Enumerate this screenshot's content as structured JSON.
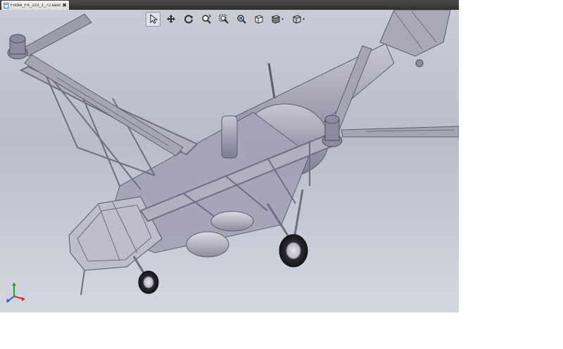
{
  "tab": {
    "title": "Focke_FA_223_1_72.easm",
    "close_glyph": "✖",
    "icon": "document-icon"
  },
  "toolbar": {
    "tools": [
      {
        "name": "select-tool",
        "icon": "cursor-arrow-icon",
        "active": true
      },
      {
        "name": "pan-tool",
        "icon": "four-way-arrow-icon",
        "active": false
      },
      {
        "name": "rotate-tool",
        "icon": "rotate-icon",
        "active": false
      },
      {
        "name": "zoom-in-out-tool",
        "icon": "zoom-in-out-icon",
        "active": false
      },
      {
        "name": "zoom-to-fit-tool",
        "icon": "zoom-to-fit-icon",
        "active": false
      },
      {
        "name": "zoom-to-area-tool",
        "icon": "zoom-to-area-icon",
        "active": false
      },
      {
        "name": "standard-views-tool",
        "icon": "cube-view-icon",
        "active": false
      },
      {
        "name": "display-style-tool",
        "icon": "shaded-cube-icon",
        "active": false,
        "has_dropdown": true
      },
      {
        "name": "view-orientation-tool",
        "icon": "wireframe-cube-icon",
        "active": false,
        "has_dropdown": true
      }
    ],
    "dropdown_caret": "▾"
  },
  "viewport": {
    "model": "helicopter-3d-model",
    "background_top": "#c9cdd8",
    "background_bottom": "#d4d7df",
    "model_color": "#a9a9b9"
  },
  "triad": {
    "axes": [
      "x",
      "y",
      "z"
    ],
    "colors": {
      "x": "#d23030",
      "y": "#2aa02a",
      "z": "#2f5fd0"
    }
  }
}
